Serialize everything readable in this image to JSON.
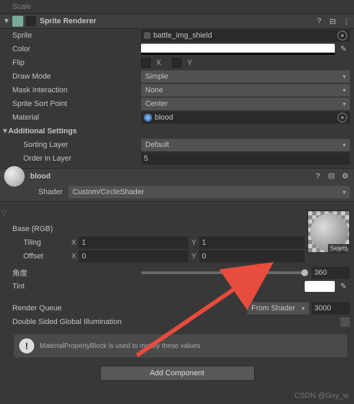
{
  "top_row": {
    "label": "Scale"
  },
  "sprite_renderer": {
    "title": "Sprite Renderer",
    "sprite_label": "Sprite",
    "sprite_value": "battle_img_shield",
    "color_label": "Color",
    "flip_label": "Flip",
    "flip_x": "X",
    "flip_y": "Y",
    "draw_mode_label": "Draw Mode",
    "draw_mode_value": "Simple",
    "mask_label": "Mask Interaction",
    "mask_value": "None",
    "sort_point_label": "Sprite Sort Point",
    "sort_point_value": "Center",
    "material_label": "Material",
    "material_value": "blood",
    "additional": "Additional Settings",
    "sorting_layer_label": "Sorting Layer",
    "sorting_layer_value": "Default",
    "order_label": "Order in Layer",
    "order_value": "5"
  },
  "material": {
    "name": "blood",
    "shader_label": "Shader",
    "shader_value": "Custom/CircleShader",
    "base_label": "Base (RGB)",
    "tiling_label": "Tiling",
    "offset_label": "Offset",
    "tiling_x": "1",
    "tiling_y": "1",
    "offset_x": "0",
    "offset_y": "0",
    "tex_select": "Select",
    "angle_label": "角度",
    "angle_value": "360",
    "tint_label": "Tint",
    "render_queue_label": "Render Queue",
    "render_queue_mode": "From Shader",
    "render_queue_value": "3000",
    "dsgi_label": "Double Sided Global Illumination",
    "info": "MaterialPropertyBlock is used to modify these values"
  },
  "add_component": "Add Component",
  "watermark": "CSDN @Gxy_w",
  "labels": {
    "x": "X",
    "y": "Y"
  }
}
